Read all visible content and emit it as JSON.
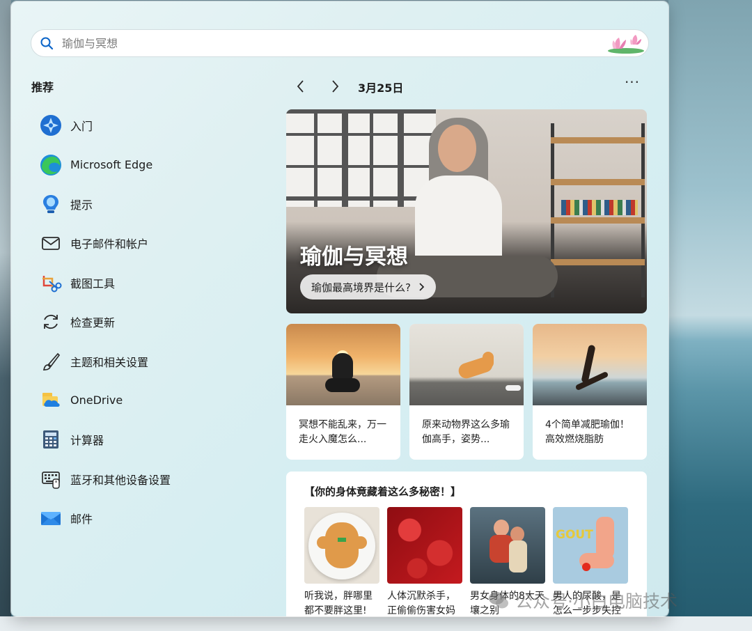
{
  "search": {
    "placeholder": "瑜伽与冥想"
  },
  "recommended": {
    "title": "推荐",
    "items": [
      {
        "label": "入门",
        "icon": "get-started-icon"
      },
      {
        "label": "Microsoft Edge",
        "icon": "edge-icon"
      },
      {
        "label": "提示",
        "icon": "tips-icon"
      },
      {
        "label": "电子邮件和帐户",
        "icon": "email-accounts-icon"
      },
      {
        "label": "截图工具",
        "icon": "snipping-tool-icon"
      },
      {
        "label": "检查更新",
        "icon": "check-updates-icon"
      },
      {
        "label": "主题和相关设置",
        "icon": "themes-brush-icon"
      },
      {
        "label": "OneDrive",
        "icon": "onedrive-icon"
      },
      {
        "label": "计算器",
        "icon": "calculator-icon"
      },
      {
        "label": "蓝牙和其他设备设置",
        "icon": "bluetooth-devices-icon"
      },
      {
        "label": "邮件",
        "icon": "mail-icon"
      }
    ]
  },
  "feed": {
    "date": "3月25日",
    "more": "···",
    "hero": {
      "title": "瑜伽与冥想",
      "cta": "瑜伽最高境界是什么?"
    },
    "cards": [
      {
        "text": "冥想不能乱来，万一走火入魔怎么..."
      },
      {
        "text": "原来动物界这么多瑜伽高手，姿势..."
      },
      {
        "text": "4个简单减肥瑜伽！高效燃烧脂肪"
      }
    ],
    "quiz": {
      "title": "【你的身体竟藏着这么多秘密！】",
      "items": [
        {
          "text": "听我说，胖哪里都不要胖这里!"
        },
        {
          "text": "人体沉默杀手，正偷偷伤害女妈"
        },
        {
          "text": "男女身体的8大天壤之别"
        },
        {
          "text": "男人的尿酸，是怎么一步步失控"
        }
      ],
      "gout_label": "GOUT"
    }
  },
  "watermark": {
    "text": "公众号·小白电脑技术"
  }
}
